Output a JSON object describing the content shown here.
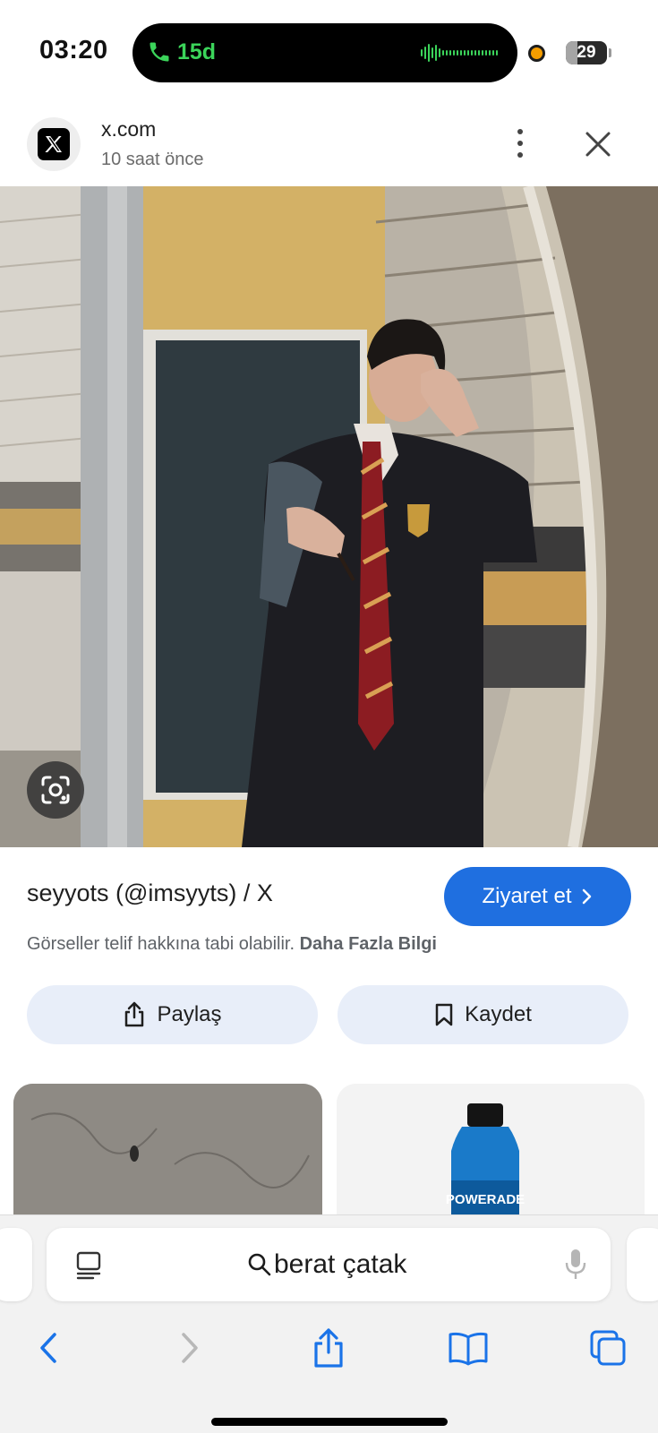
{
  "status_bar": {
    "time": "03:20",
    "call_duration": "15d",
    "battery_level": "29",
    "battery_fraction": 0.29
  },
  "source": {
    "domain": "x.com",
    "time_ago": "10 saat önce",
    "logo_icon": "x-logo-icon"
  },
  "result": {
    "title": "seyyots (@imsyyts) / X",
    "visit_label": "Ziyaret et",
    "copyright_text": "Görseller telif hakkına tabi olabilir.",
    "more_info_link": "Daha Fazla Bilgi"
  },
  "actions": {
    "share_label": "Paylaş",
    "save_label": "Kaydet"
  },
  "related": {
    "right_thumb_brand": "POWERADE"
  },
  "browser": {
    "search_query": "berat çatak"
  },
  "colors": {
    "accent_blue": "#1f6fe0",
    "action_bg": "#e8eef9",
    "call_green": "#3bd45a",
    "toolbar_blue": "#1a73e8"
  }
}
